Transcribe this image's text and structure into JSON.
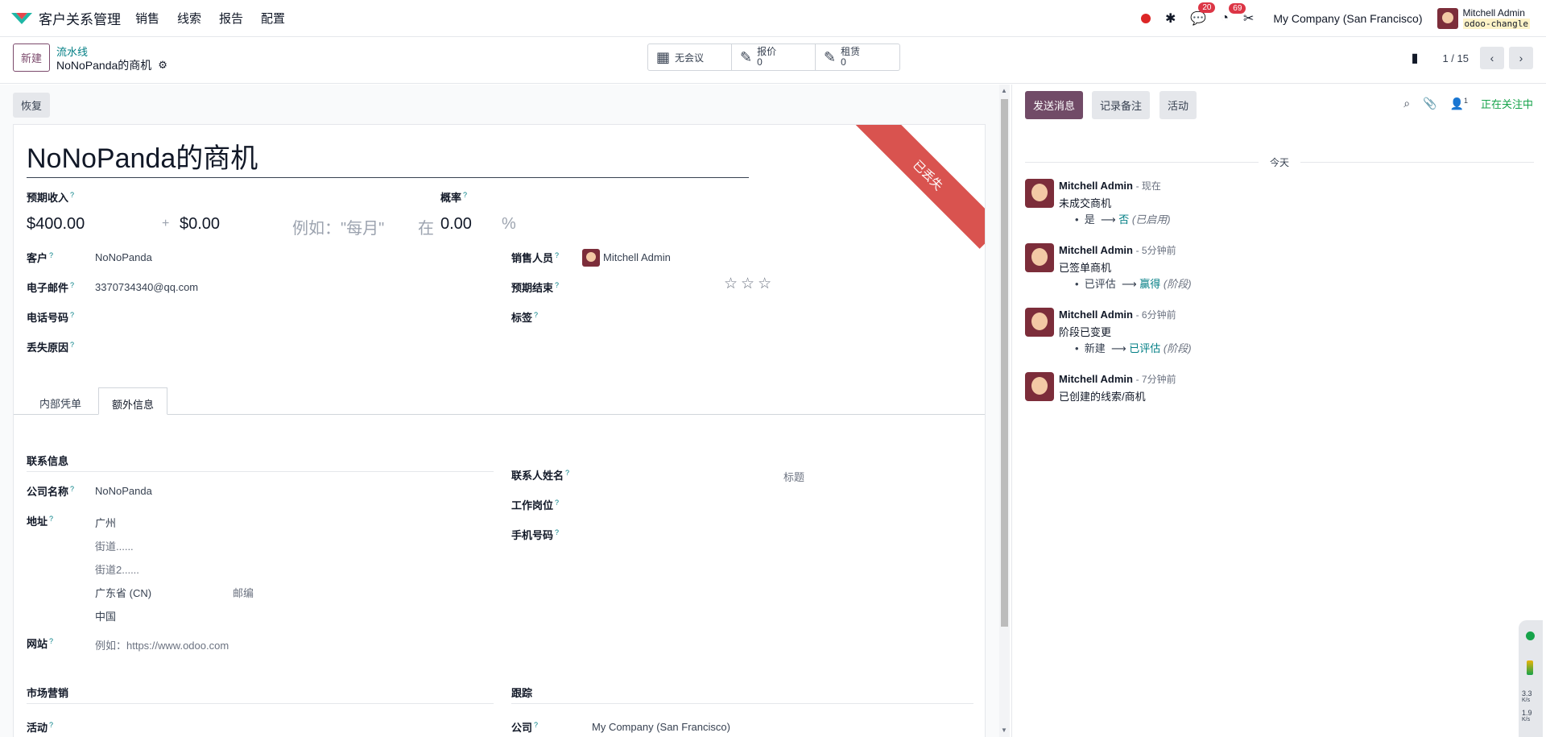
{
  "navbar": {
    "app_name": "客户关系管理",
    "menu": [
      "销售",
      "线索",
      "报告",
      "配置"
    ],
    "chat_badge": "20",
    "activity_badge": "69",
    "company": "My Company (San Francisco)",
    "user_name": "Mitchell Admin",
    "db_name": "odoo-changle"
  },
  "control": {
    "new_label": "新建",
    "breadcrumb_parent": "流水线",
    "breadcrumb_current": "NoNoPanda的商机",
    "stats": [
      {
        "label": "无会议",
        "value": ""
      },
      {
        "label": "报价",
        "value": "0"
      },
      {
        "label": "租赁",
        "value": "0"
      }
    ],
    "pager": "1 / 15"
  },
  "form": {
    "restore_label": "恢复",
    "ribbon": "已丢失",
    "title": "NoNoPanda的商机",
    "expected_revenue_label": "预期收入",
    "expected_revenue": "$400.00",
    "plus": "+",
    "recurring_revenue": "$0.00",
    "recurring_plan_placeholder": "例如：\"每月\"",
    "at": "在",
    "probability_label": "概率",
    "probability": "0.00",
    "percent": "%",
    "customer_label": "客户",
    "customer": "NoNoPanda",
    "email_label": "电子邮件",
    "email": "3370734340@qq.com",
    "phone_label": "电话号码",
    "lost_reason_label": "丢失原因",
    "salesperson_label": "销售人员",
    "salesperson": "Mitchell Admin",
    "expected_closing_label": "预期结束",
    "stars": "☆☆☆",
    "tags_label": "标签",
    "tab_internal": "内部凭单",
    "tab_extra": "额外信息",
    "section_contact": "联系信息",
    "company_name_label": "公司名称",
    "company_name": "NoNoPanda",
    "address_label": "地址",
    "city": "广州",
    "street": "街道......",
    "street2": "街道2......",
    "state": "广东省 (CN)",
    "zip_placeholder": "邮编",
    "country": "中国",
    "website_label": "网站",
    "website_placeholder": "例如：https://www.odoo.com",
    "contact_name_label": "联系人姓名",
    "title_placeholder": "标题",
    "job_position_label": "工作岗位",
    "mobile_label": "手机号码",
    "section_marketing": "市场营销",
    "campaign_label": "活动",
    "section_tracking": "跟踪",
    "company_label": "公司",
    "company_value": "My Company (San Francisco)"
  },
  "chatter": {
    "send_message": "发送消息",
    "log_note": "记录备注",
    "activities": "活动",
    "followers_count": "1",
    "following": "正在关注中",
    "today": "今天",
    "messages": [
      {
        "author": "Mitchell Admin",
        "time": "- 现在",
        "body": "未成交商机",
        "old": "是",
        "new": "否",
        "field": "(已启用)"
      },
      {
        "author": "Mitchell Admin",
        "time": "- 5分钟前",
        "body": "已签单商机",
        "old": "已评估",
        "new": "赢得",
        "field": "(阶段)"
      },
      {
        "author": "Mitchell Admin",
        "time": "- 6分钟前",
        "body": "阶段已变更",
        "old": "新建",
        "new": "已评估",
        "field": "(阶段)"
      },
      {
        "author": "Mitchell Admin",
        "time": "- 7分钟前",
        "body": "已创建的线索/商机",
        "old": "",
        "new": "",
        "field": ""
      }
    ]
  },
  "status_widget": {
    "up": "3.3",
    "up_unit": "K/s",
    "down": "1.9",
    "down_unit": "K/s"
  },
  "colors": {
    "brand": "#714b67",
    "ribbon": "#d9534f",
    "link": "#017e84",
    "following": "#16a34a"
  }
}
